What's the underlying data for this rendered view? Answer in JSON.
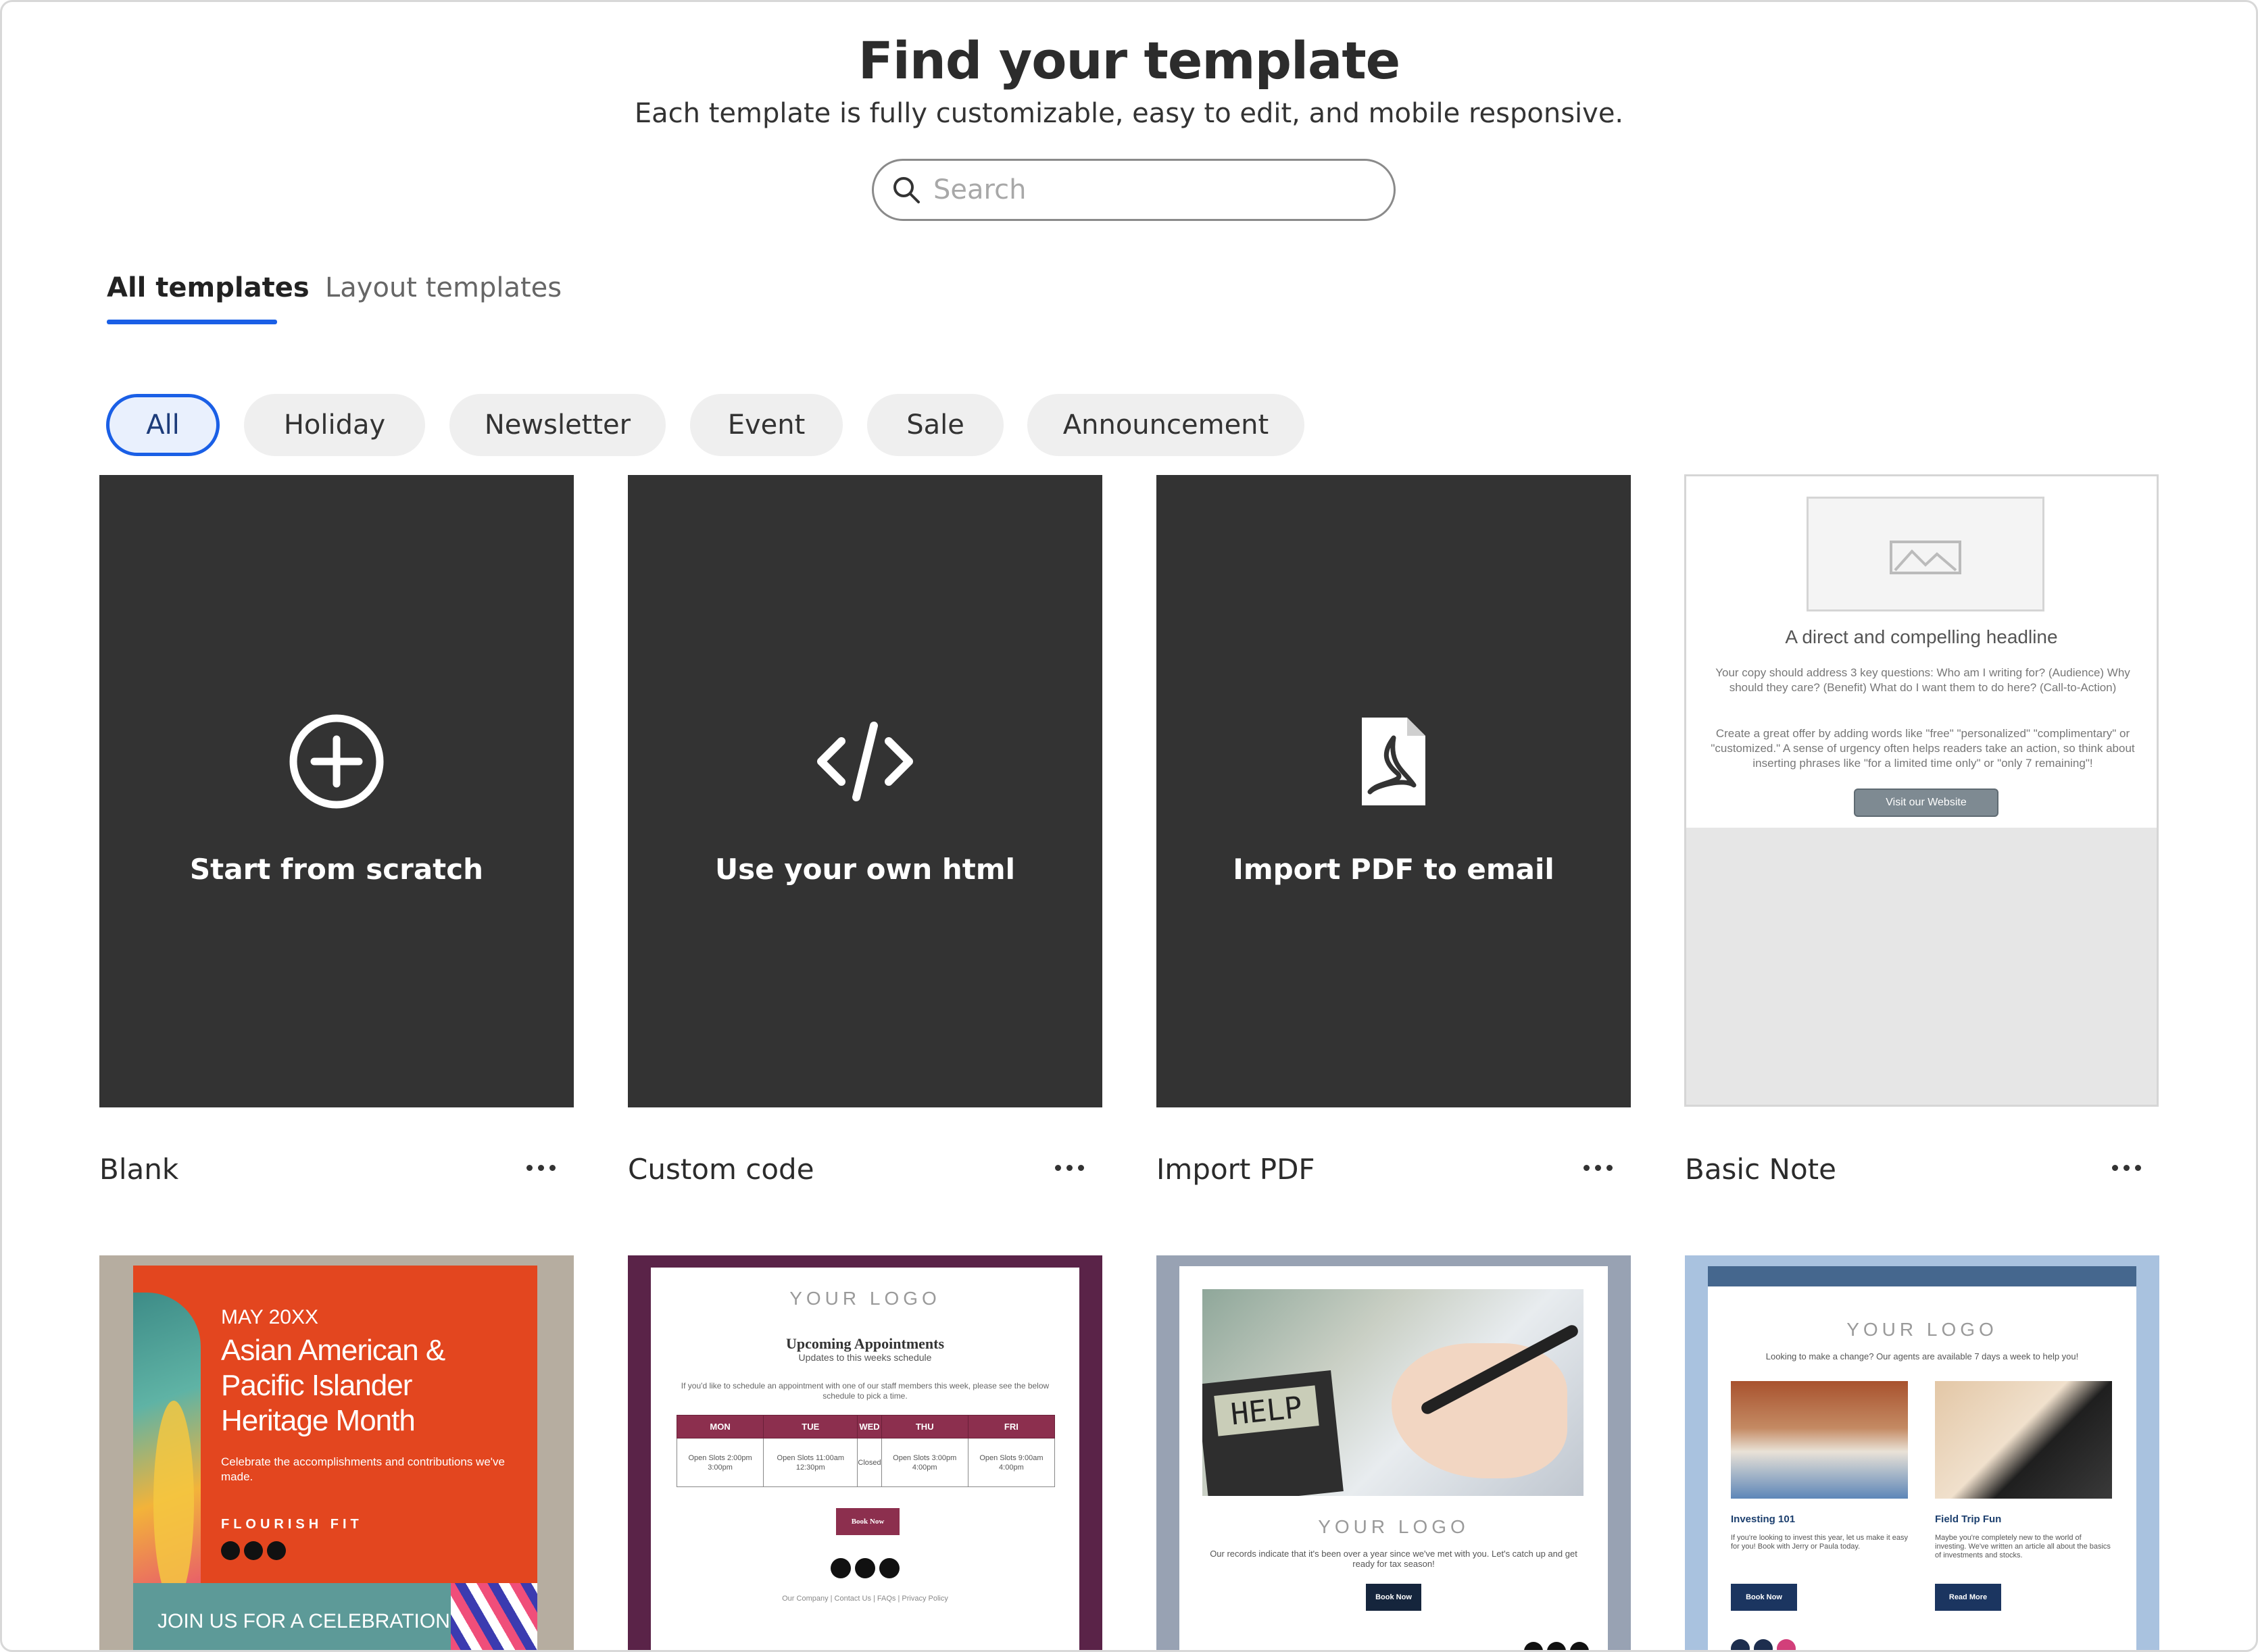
{
  "header": {
    "title": "Find your template",
    "subtitle": "Each template is fully customizable, easy to edit, and mobile responsive."
  },
  "search": {
    "placeholder": "Search",
    "value": ""
  },
  "tabs": [
    {
      "label": "All templates",
      "active": true
    },
    {
      "label": "Layout templates",
      "active": false
    }
  ],
  "filters": [
    {
      "label": "All",
      "active": true
    },
    {
      "label": "Holiday"
    },
    {
      "label": "Newsletter"
    },
    {
      "label": "Event"
    },
    {
      "label": "Sale"
    },
    {
      "label": "Announcement"
    }
  ],
  "cards": [
    {
      "name": "Blank",
      "label": "Start from scratch",
      "icon": "plus-circle-icon"
    },
    {
      "name": "Custom code",
      "label": "Use your own html",
      "icon": "code-icon"
    },
    {
      "name": "Import PDF",
      "label": "Import PDF to email",
      "icon": "pdf-file-icon"
    },
    {
      "name": "Basic Note",
      "preview": {
        "headline": "A direct and compelling headline",
        "para1": "Your copy should address 3 key questions: Who am I writing for? (Audience) Why should they care? (Benefit) What do I want them to do here? (Call-to-Action)",
        "para2": "Create a great offer by adding words like \"free\" \"personalized\" \"complimentary\" or \"customized.\" A sense of urgency often helps readers take an action, so think about inserting phrases like \"for a limited time only\" or \"only 7 remaining\"!",
        "button": "Visit our Website"
      }
    }
  ],
  "bottom_previews": {
    "aapi": {
      "date": "MAY 20XX",
      "headline": "Asian American & Pacific Islander Heritage Month",
      "sub": "Celebrate the accomplishments and contributions we've made.",
      "brand": "FLOURISH FIT",
      "banner": "JOIN US FOR A CELEBRATION"
    },
    "appointments": {
      "logo": "YOUR LOGO",
      "title": "Upcoming Appointments",
      "subtitle": "Updates to this weeks schedule",
      "para": "If you'd like to schedule an appointment with one of our staff members this week, please see the below schedule to pick a time.",
      "days": [
        "MON",
        "TUE",
        "WED",
        "THU",
        "FRI"
      ],
      "slots": [
        "Open Slots 2:00pm 3:00pm",
        "Open Slots 11:00am 12:30pm",
        "Closed",
        "Open Slots 3:00pm 4:00pm",
        "Open Slots 9:00am 4:00pm"
      ],
      "button": "Book Now",
      "footer": "Our Company | Contact Us | FAQs | Privacy Policy"
    },
    "tax": {
      "calc_text": "HELP",
      "logo": "YOUR LOGO",
      "para": "Our records indicate that it's been over a year since we've met with you. Let's catch up and get ready for tax season!",
      "button": "Book Now"
    },
    "investing": {
      "logo": "YOUR LOGO",
      "tagline": "Looking to make a change? Our agents are available 7 days a week to help you!",
      "col1_title": "Investing 101",
      "col1_text": "If you're looking to invest this year, let us make it easy for you! Book with Jerry or Paula today.",
      "col1_button": "Book Now",
      "col2_title": "Field Trip Fun",
      "col2_text": "Maybe you're completely new to the world of investing. We've written an article all about the basics of investments and stocks.",
      "col2_button": "Read More"
    }
  },
  "colors": {
    "accent": "#1a5fe6",
    "card_dark": "#333333"
  }
}
